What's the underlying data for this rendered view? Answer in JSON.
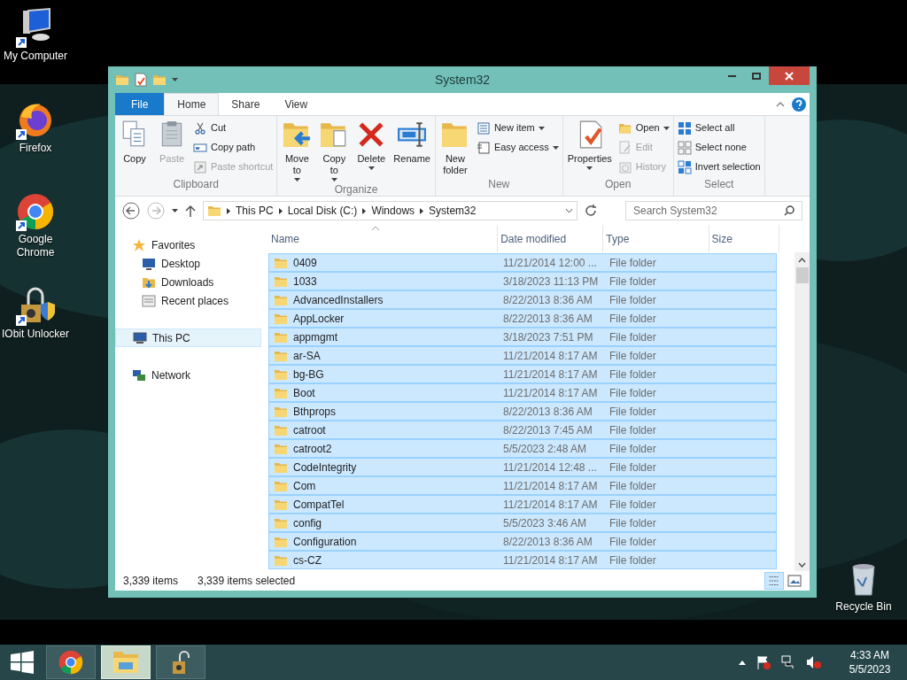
{
  "desktop_icons": [
    {
      "label": "My Computer"
    },
    {
      "label": "Firefox"
    },
    {
      "label": "Google Chrome"
    },
    {
      "label": "IObit Unlocker"
    },
    {
      "label": "Recycle Bin"
    }
  ],
  "window": {
    "title": "System32",
    "tabs": [
      {
        "label": "File",
        "kind": "file",
        "selected": false
      },
      {
        "label": "Home",
        "kind": "tab",
        "selected": true
      },
      {
        "label": "Share",
        "kind": "tab",
        "selected": false
      },
      {
        "label": "View",
        "kind": "tab",
        "selected": false
      }
    ],
    "ribbon": [
      {
        "label": "Clipboard",
        "items": [
          {
            "label": "Copy",
            "kind": "large",
            "disabled": false,
            "dropdown": false
          },
          {
            "label": "Paste",
            "kind": "large",
            "disabled": true,
            "dropdown": false
          },
          {
            "label": "Cut",
            "kind": "small",
            "disabled": false,
            "dropdown": false
          },
          {
            "label": "Copy path",
            "kind": "small",
            "disabled": false,
            "dropdown": false
          },
          {
            "label": "Paste shortcut",
            "kind": "small",
            "disabled": true,
            "dropdown": false
          }
        ]
      },
      {
        "label": "Organize",
        "items": [
          {
            "label": "Move to",
            "kind": "large",
            "disabled": false,
            "dropdown": true
          },
          {
            "label": "Copy to",
            "kind": "large",
            "disabled": false,
            "dropdown": true
          },
          {
            "label": "Delete",
            "kind": "large",
            "disabled": false,
            "dropdown": true
          },
          {
            "label": "Rename",
            "kind": "large",
            "disabled": false,
            "dropdown": false
          }
        ]
      },
      {
        "label": "New",
        "items": [
          {
            "label": "New folder",
            "kind": "large",
            "disabled": false,
            "dropdown": false
          },
          {
            "label": "New item",
            "kind": "small",
            "disabled": false,
            "dropdown": true
          },
          {
            "label": "Easy access",
            "kind": "small",
            "disabled": false,
            "dropdown": true
          }
        ]
      },
      {
        "label": "Open",
        "items": [
          {
            "label": "Properties",
            "kind": "large",
            "disabled": false,
            "dropdown": true
          },
          {
            "label": "Open",
            "kind": "small",
            "disabled": false,
            "dropdown": true
          },
          {
            "label": "Edit",
            "kind": "small",
            "disabled": true,
            "dropdown": false
          },
          {
            "label": "History",
            "kind": "small",
            "disabled": true,
            "dropdown": false
          }
        ]
      },
      {
        "label": "Select",
        "items": [
          {
            "label": "Select all",
            "kind": "small",
            "disabled": false,
            "dropdown": false
          },
          {
            "label": "Select none",
            "kind": "small",
            "disabled": false,
            "dropdown": false
          },
          {
            "label": "Invert selection",
            "kind": "small",
            "disabled": false,
            "dropdown": false
          }
        ]
      }
    ],
    "breadcrumb": [
      "This PC",
      "Local Disk (C:)",
      "Windows",
      "System32"
    ],
    "search": {
      "placeholder": "Search System32"
    },
    "nav_pane": [
      {
        "label": "Favorites",
        "selected": false,
        "children": [
          {
            "label": "Desktop",
            "selected": false
          },
          {
            "label": "Downloads",
            "selected": false
          },
          {
            "label": "Recent places",
            "selected": false
          }
        ]
      },
      {
        "label": "This PC",
        "selected": true
      },
      {
        "label": "Network",
        "selected": false
      }
    ],
    "columns": [
      "Name",
      "Date modified",
      "Type",
      "Size"
    ],
    "rows": [
      {
        "name": "0409",
        "date": "11/21/2014 12:00 ...",
        "type": "File folder",
        "selected": true
      },
      {
        "name": "1033",
        "date": "3/18/2023 11:13 PM",
        "type": "File folder",
        "selected": true
      },
      {
        "name": "AdvancedInstallers",
        "date": "8/22/2013 8:36 AM",
        "type": "File folder",
        "selected": true
      },
      {
        "name": "AppLocker",
        "date": "8/22/2013 8:36 AM",
        "type": "File folder",
        "selected": true
      },
      {
        "name": "appmgmt",
        "date": "3/18/2023 7:51 PM",
        "type": "File folder",
        "selected": true
      },
      {
        "name": "ar-SA",
        "date": "11/21/2014 8:17 AM",
        "type": "File folder",
        "selected": true
      },
      {
        "name": "bg-BG",
        "date": "11/21/2014 8:17 AM",
        "type": "File folder",
        "selected": true
      },
      {
        "name": "Boot",
        "date": "11/21/2014 8:17 AM",
        "type": "File folder",
        "selected": true
      },
      {
        "name": "Bthprops",
        "date": "8/22/2013 8:36 AM",
        "type": "File folder",
        "selected": true
      },
      {
        "name": "catroot",
        "date": "8/22/2013 7:45 AM",
        "type": "File folder",
        "selected": true
      },
      {
        "name": "catroot2",
        "date": "5/5/2023 2:48 AM",
        "type": "File folder",
        "selected": true
      },
      {
        "name": "CodeIntegrity",
        "date": "11/21/2014 12:48 ...",
        "type": "File folder",
        "selected": true
      },
      {
        "name": "Com",
        "date": "11/21/2014 8:17 AM",
        "type": "File folder",
        "selected": true
      },
      {
        "name": "CompatTel",
        "date": "11/21/2014 8:17 AM",
        "type": "File folder",
        "selected": true
      },
      {
        "name": "config",
        "date": "5/5/2023 3:46 AM",
        "type": "File folder",
        "selected": true
      },
      {
        "name": "Configuration",
        "date": "8/22/2013 8:36 AM",
        "type": "File folder",
        "selected": true
      },
      {
        "name": "cs-CZ",
        "date": "11/21/2014 8:17 AM",
        "type": "File folder",
        "selected": true
      }
    ],
    "status": {
      "count": "3,339 items",
      "selection": "3,339 items selected"
    }
  },
  "taskbar": {
    "apps": [
      {
        "kind": "chrome",
        "selected": false
      },
      {
        "kind": "explorer",
        "selected": true
      },
      {
        "kind": "unlocker",
        "selected": false
      }
    ],
    "time": "4:33 AM",
    "date": "5/5/2023"
  }
}
